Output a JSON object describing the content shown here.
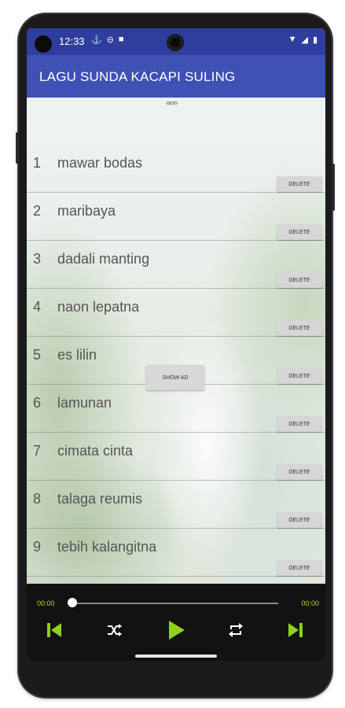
{
  "status_bar": {
    "time": "12:33"
  },
  "app_bar": {
    "title": "LAGU SUNDA KACAPI SULING"
  },
  "ad_banner": {
    "label": "ocro"
  },
  "songs": [
    {
      "num": "1",
      "title": "mawar bodas",
      "delete_label": "DELETE"
    },
    {
      "num": "2",
      "title": "maribaya",
      "delete_label": "DELETE"
    },
    {
      "num": "3",
      "title": "dadali manting",
      "delete_label": "DELETE"
    },
    {
      "num": "4",
      "title": "naon lepatna",
      "delete_label": "DELETE"
    },
    {
      "num": "5",
      "title": "es lilin",
      "delete_label": "DELETE"
    },
    {
      "num": "6",
      "title": "lamunan",
      "delete_label": "DELETE"
    },
    {
      "num": "7",
      "title": "cimata cinta",
      "delete_label": "DELETE"
    },
    {
      "num": "8",
      "title": "talaga reumis",
      "delete_label": "DELETE"
    },
    {
      "num": "9",
      "title": "tebih kalangitna",
      "delete_label": "DELETE"
    }
  ],
  "show_ad_button": {
    "label": "SHOW AD"
  },
  "player": {
    "elapsed": "00:00",
    "duration": "00:00",
    "progress": 0,
    "accent_color": "#8fd11f",
    "controls": [
      "skip-previous-icon",
      "shuffle-icon",
      "play-icon",
      "repeat-icon",
      "skip-next-icon"
    ]
  }
}
